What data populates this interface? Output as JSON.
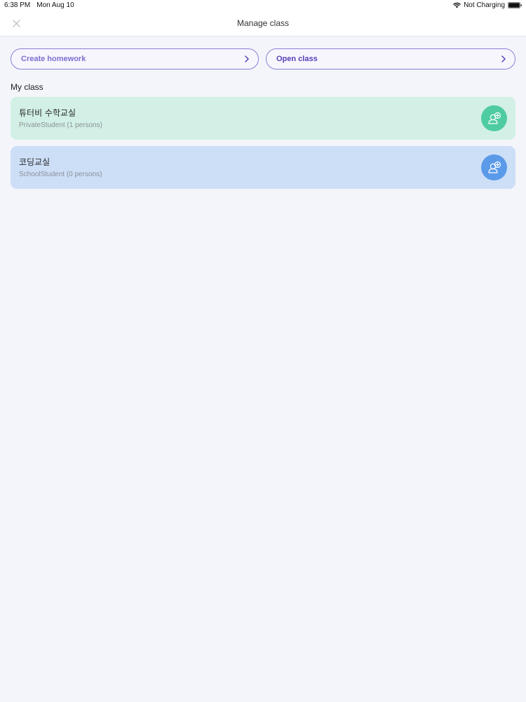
{
  "status_bar": {
    "time": "6:38 PM",
    "date": "Mon Aug 10",
    "battery_text": "Not Charging"
  },
  "nav": {
    "title": "Manage class",
    "close_icon": "close-icon"
  },
  "actions": {
    "create_homework": "Create homework",
    "open_class": "Open class"
  },
  "section": {
    "title": "My class"
  },
  "classes": [
    {
      "name": "튜터비 수학교실",
      "subtitle": "PrivateStudent (1 persons)",
      "color": "#d2f0e5",
      "accent": "#4fcba2"
    },
    {
      "name": "코딩교실",
      "subtitle": "SchoolStudent (0 persons)",
      "color": "#cddff7",
      "accent": "#5b9ae8"
    }
  ],
  "colors": {
    "primary": "#7b6fd0",
    "primary_dark": "#5a3fb8",
    "background": "#f3f5fb"
  }
}
